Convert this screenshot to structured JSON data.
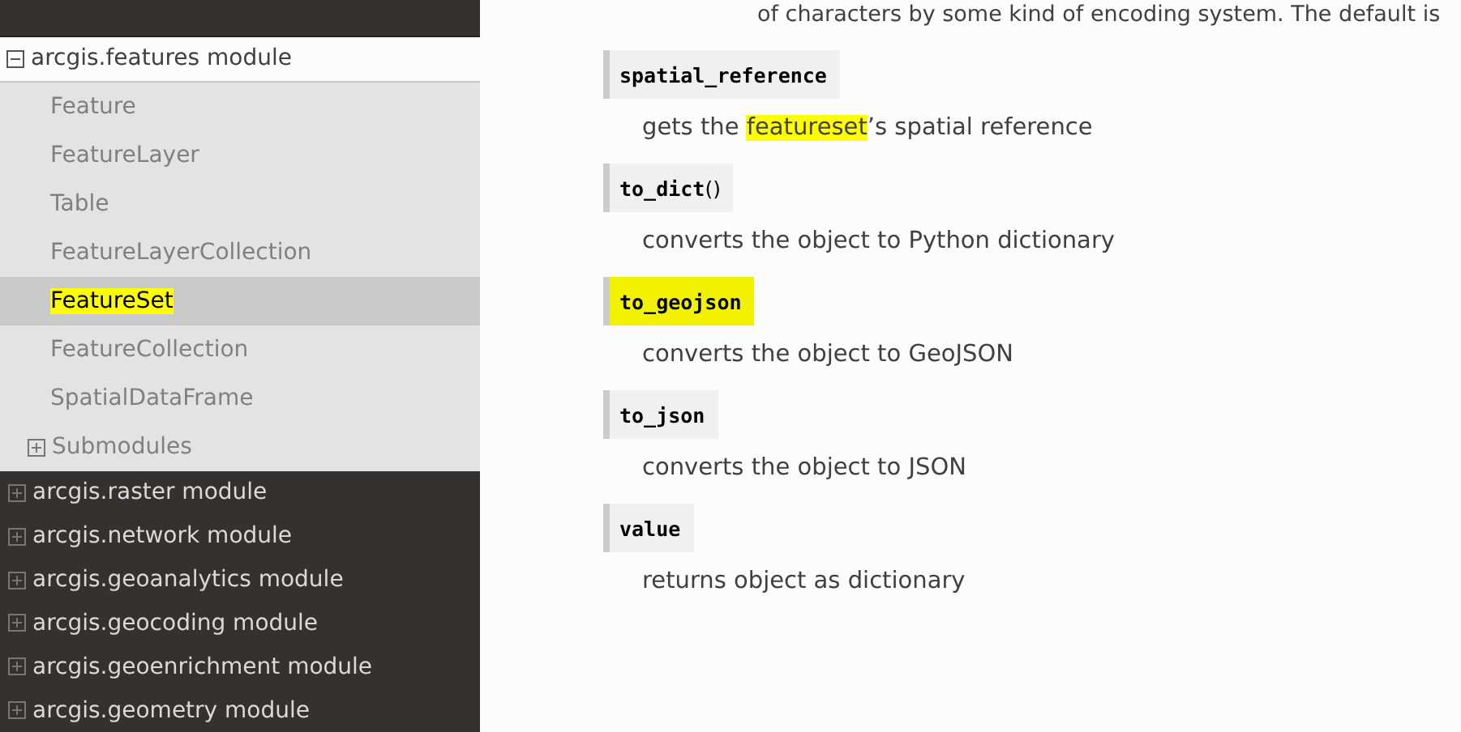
{
  "sidebar": {
    "current_module": {
      "label": "arcgis.features module",
      "expanded": true,
      "items": [
        {
          "label": "Feature",
          "selected": false
        },
        {
          "label": "FeatureLayer",
          "selected": false
        },
        {
          "label": "Table",
          "selected": false
        },
        {
          "label": "FeatureLayerCollection",
          "selected": false
        },
        {
          "label": "FeatureSet",
          "selected": true
        },
        {
          "label": "FeatureCollection",
          "selected": false
        },
        {
          "label": "SpatialDataFrame",
          "selected": false
        }
      ],
      "submodules": {
        "label": "Submodules",
        "expanded": false
      }
    },
    "modules": [
      {
        "label": "arcgis.raster module",
        "expanded": false
      },
      {
        "label": "arcgis.network module",
        "expanded": false
      },
      {
        "label": "arcgis.geoanalytics module",
        "expanded": false
      },
      {
        "label": "arcgis.geocoding module",
        "expanded": false
      },
      {
        "label": "arcgis.geoenrichment module",
        "expanded": false
      },
      {
        "label": "arcgis.geometry module",
        "expanded": false
      }
    ]
  },
  "content": {
    "intro_tail": "of characters by some kind of encoding system. The default is",
    "members": [
      {
        "name": "spatial_reference",
        "highlighted": false,
        "description": [
          {
            "text": "gets the ",
            "highlighted": false
          },
          {
            "text": "featureset",
            "highlighted": true
          },
          {
            "text": "’s spatial reference",
            "highlighted": false
          }
        ]
      },
      {
        "name": "to_dict",
        "suffix": "()",
        "highlighted": false,
        "description": [
          {
            "text": "converts the object to Python dictionary",
            "highlighted": false
          }
        ]
      },
      {
        "name": "to_geojson",
        "highlighted": true,
        "description": [
          {
            "text": "converts the object to GeoJSON",
            "highlighted": false
          }
        ]
      },
      {
        "name": "to_json",
        "highlighted": false,
        "description": [
          {
            "text": "converts the object to JSON",
            "highlighted": false
          }
        ]
      },
      {
        "name": "value",
        "highlighted": false,
        "description": [
          {
            "text": "returns object as dictionary",
            "highlighted": false
          }
        ]
      }
    ]
  }
}
